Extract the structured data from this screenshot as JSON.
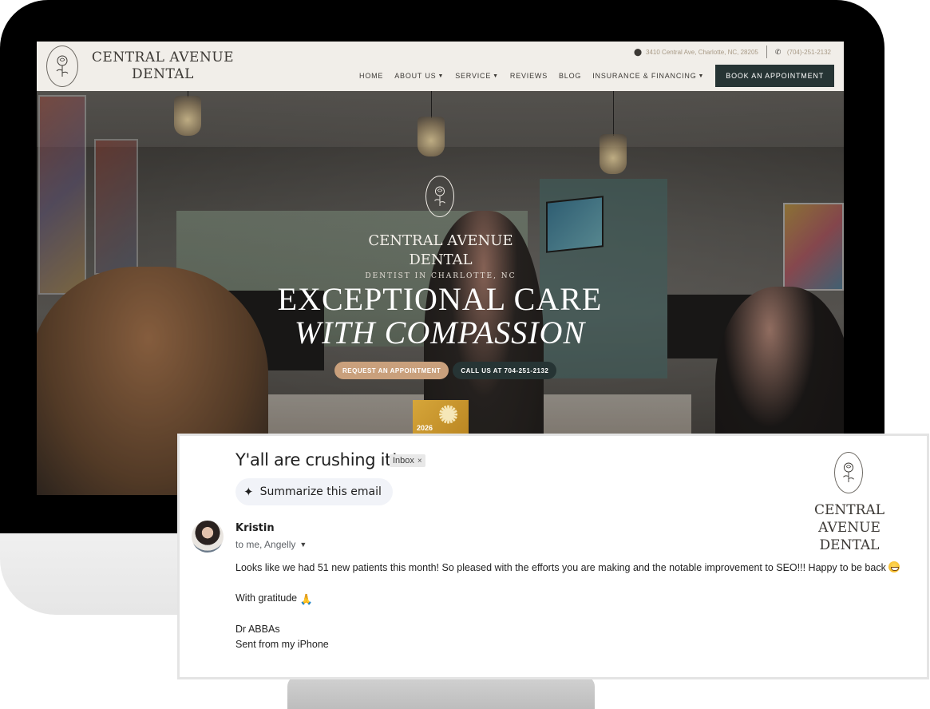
{
  "website": {
    "logo": {
      "line1": "CENTRAL AVENUE",
      "line2": "DENTAL"
    },
    "contact": {
      "address": "3410 Central Ave, Charlotte, NC, 28205",
      "phone": "(704)-251-2132"
    },
    "nav": [
      {
        "label": "HOME",
        "has_dropdown": false
      },
      {
        "label": "ABOUT US",
        "has_dropdown": true
      },
      {
        "label": "SERVICE",
        "has_dropdown": true
      },
      {
        "label": "REVIEWS",
        "has_dropdown": false
      },
      {
        "label": "BLOG",
        "has_dropdown": false
      },
      {
        "label": "INSURANCE & FINANCING",
        "has_dropdown": true
      }
    ],
    "book_button": "BOOK AN APPOINTMENT",
    "hero": {
      "logo_line1": "CENTRAL AVENUE",
      "logo_line2": "DENTAL",
      "subtitle": "DENTIST IN CHARLOTTE, NC",
      "title_line1": "EXCEPTIONAL CARE",
      "title_line2": "WITH COMPASSION",
      "request_button": "REQUEST AN APPOINTMENT",
      "call_button": "CALL US AT 704-251-2132",
      "award_year": "2026"
    },
    "colors": {
      "header_bg": "#f1eee9",
      "dark_teal": "#263434",
      "tan": "#c9a07c",
      "gold": "#d6a63a"
    }
  },
  "email": {
    "subject": "Y'all are crushing it!",
    "label_chip": "Inbox",
    "label_close": "×",
    "summarize_button": "Summarize this email",
    "sender": "Kristin",
    "recipients": "to me, Angelly",
    "body": {
      "line1": "Looks like we had 51 new patients this month!  So pleased with the efforts you are making and the notable improvement to SEO!!!  Happy to be back",
      "line2": "With gratitude",
      "line3": "Dr ABBAs",
      "line4": "Sent from my iPhone"
    },
    "logo": {
      "line1": "CENTRAL AVENUE",
      "line2": "DENTAL"
    },
    "icons": {
      "summarize": "sparkle-icon",
      "grin": "grinning-face-icon",
      "gratitude": "folded-hands-icon",
      "recipients": "caret-down-icon"
    }
  }
}
